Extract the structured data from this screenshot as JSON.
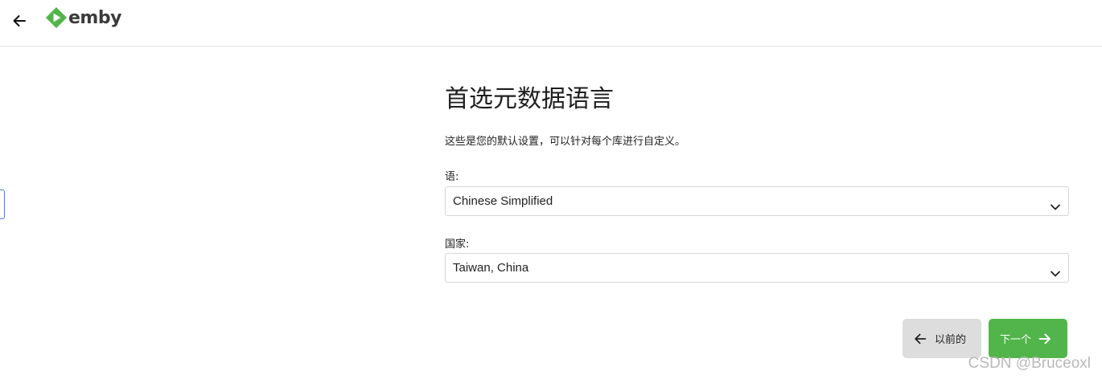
{
  "header": {
    "logo_text": "emby",
    "brand_color": "#52b54b",
    "back_icon": "arrow-left-icon"
  },
  "main": {
    "title": "首选元数据语言",
    "description": "这些是您的默认设置，可以针对每个库进行自定义。",
    "fields": [
      {
        "label": "语:",
        "value": "Chinese Simplified"
      },
      {
        "label": "国家:",
        "value": "Taiwan, China"
      }
    ]
  },
  "buttons": {
    "previous_label": "以前的",
    "next_label": "下一个",
    "previous_icon": "arrow-left-icon",
    "next_icon": "arrow-right-icon",
    "next_color": "#52b54b",
    "previous_color": "#dddddd"
  },
  "watermark": "CSDN @Bruceoxl"
}
